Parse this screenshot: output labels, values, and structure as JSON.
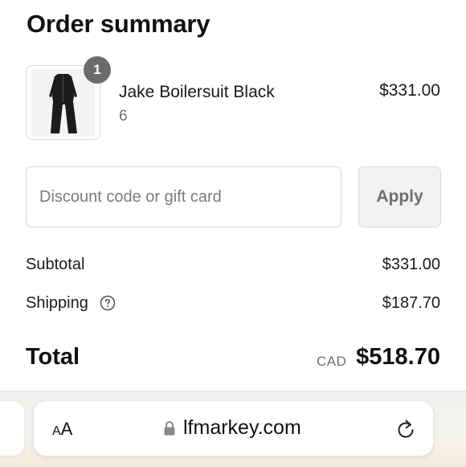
{
  "header": {
    "title": "Order summary"
  },
  "item": {
    "name": "Jake Boilersuit Black",
    "variant": "6",
    "price": "$331.00",
    "quantity": "1",
    "image_icon": "boilersuit-thumbnail"
  },
  "discount": {
    "placeholder": "Discount code or gift card",
    "value": "",
    "apply_label": "Apply"
  },
  "summary": {
    "subtotal_label": "Subtotal",
    "subtotal_value": "$331.00",
    "shipping_label": "Shipping",
    "shipping_value": "$187.70",
    "shipping_help_icon": "question-circle-icon",
    "total_label": "Total",
    "total_currency": "CAD",
    "total_value": "$518.70"
  },
  "browser": {
    "text_size_small": "A",
    "text_size_large": "A",
    "url": "lfmarkey.com",
    "lock_icon": "lock-icon",
    "reload_icon": "reload-icon"
  },
  "colors": {
    "badge": "#6b6b6b",
    "muted_text": "#707070",
    "border": "#d9d9d9",
    "button_bg": "#f2f2f2"
  }
}
